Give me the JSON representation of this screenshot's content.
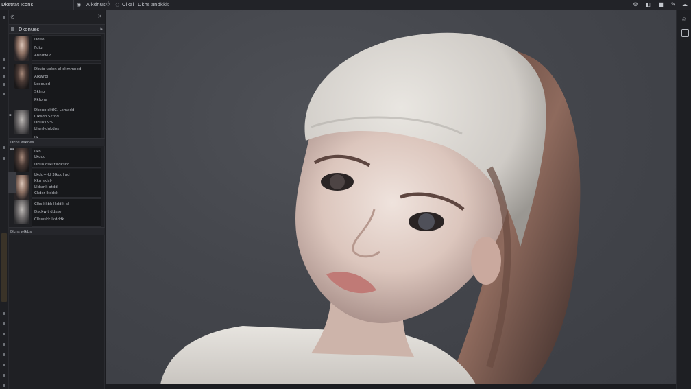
{
  "topbar": {
    "app_title": "Dkstrat Icons",
    "mode_label": "Alkdnus",
    "tab_a": "Olkal",
    "tab_b": "Dkns andkkk",
    "icons": [
      "eye-icon",
      "link-icon",
      "view-icon",
      "gear-icon",
      "fill-icon",
      "square-icon",
      "pen-icon",
      "cloud-icon"
    ]
  },
  "left_panel": {
    "layers_label": "Dkonues",
    "group_a": "Dkns wlkdes",
    "group_b": "Dkns wlkbs",
    "blocks": [
      {
        "lines": [
          "Ddeo",
          "Fdig",
          "Anndwuc"
        ]
      },
      {
        "lines": [
          "Dkuio ublon al ckmmnod",
          "Alkwrbl",
          "Lcoouod",
          "Sklno",
          "Pkfone"
        ]
      },
      {
        "lines": [
          "Dkeuo cktlC. Lkmadd",
          "Clksdo Sktdd",
          "Dkuo'l 9%",
          "Llwnl-dnkdos",
          "Lk"
        ]
      },
      {
        "lines": [
          "Lkn",
          "Lkudd",
          "Dkuo oskl t=dkskd"
        ]
      },
      {
        "lines": [
          "Lkdd=-kl 3lkddl ad",
          "Kkn sklsl-",
          "Lldsmk otdd",
          "Ckdsr lkddsk"
        ]
      },
      {
        "lines": [
          "Clks kkbk lkddlk sl",
          "Dsckwlt ddsse",
          "Cllswskk lkdddk"
        ]
      }
    ]
  },
  "colors": {
    "chrome": "#1f2024",
    "canvas": "#44464c",
    "text": "#c9ccd2"
  }
}
